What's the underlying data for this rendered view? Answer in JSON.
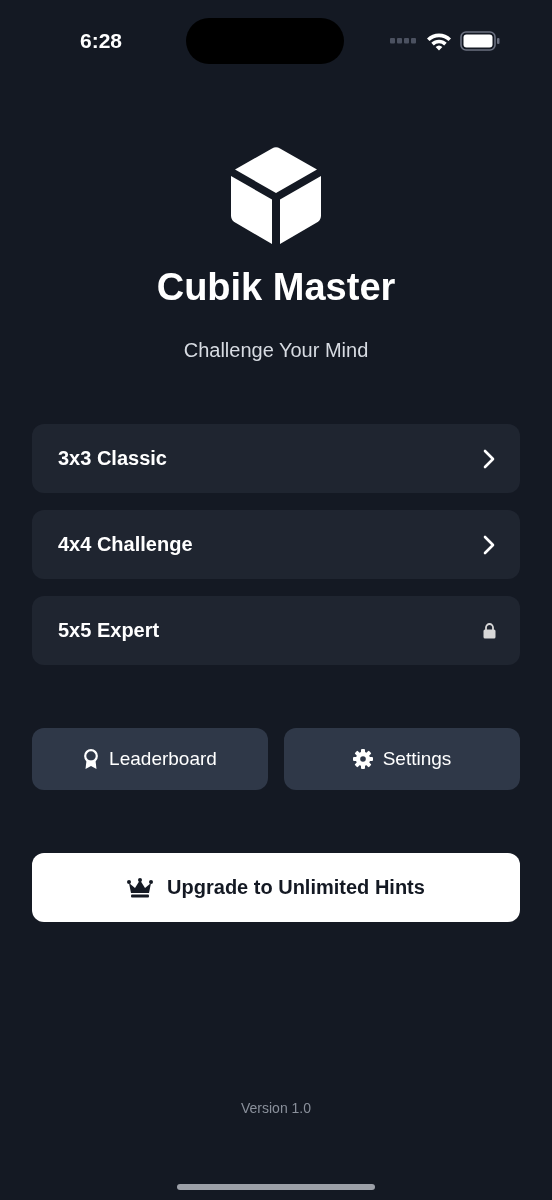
{
  "status_bar": {
    "time": "6:28"
  },
  "app": {
    "title": "Cubik Master",
    "subtitle": "Challenge Your Mind"
  },
  "modes": [
    {
      "label": "3x3 Classic",
      "locked": false
    },
    {
      "label": "4x4 Challenge",
      "locked": false
    },
    {
      "label": "5x5 Expert",
      "locked": true
    }
  ],
  "actions": [
    {
      "label": "Leaderboard",
      "kind": "leaderboard"
    },
    {
      "label": "Settings",
      "kind": "settings"
    }
  ],
  "upgrade": {
    "label": "Upgrade to Unlimited Hints"
  },
  "version": "Version 1.0"
}
